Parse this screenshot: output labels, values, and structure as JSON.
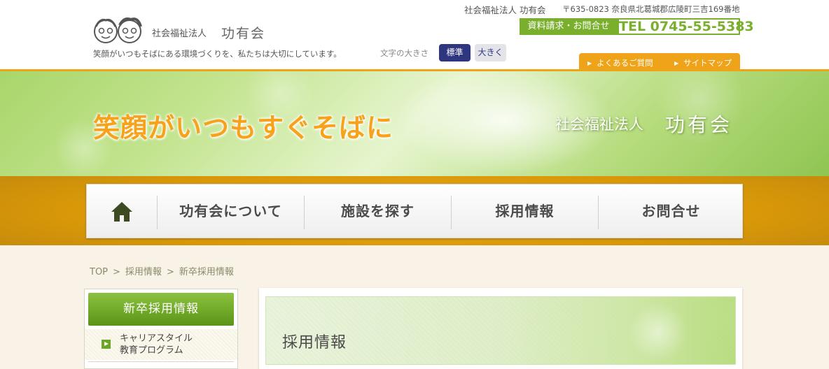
{
  "header": {
    "org_prefix": "社会福祉法人",
    "org_name": "功有会",
    "tagline": "笑顔がいつもそばにある環境づくりを、私たちは大切にしています。",
    "text_size": {
      "label": "文字の大きさ",
      "standard": "標準",
      "large": "大きく"
    },
    "address_org": "社会福祉法人 功有会",
    "address": "〒635-0823 奈良県北葛城郡広陵町三吉169番地",
    "contact_button": "資料請求・お問合せ",
    "tel": "TEL 0745-55-5383",
    "sublinks": [
      "よくあるご質問",
      "サイトマップ"
    ],
    "colors": {
      "accent_orange": "#eea318",
      "accent_green": "#7aaf2d",
      "navy": "#2f3680"
    }
  },
  "banner": {
    "slogan": "笑顔がいつもすぐそばに",
    "org_prefix": "社会福祉法人",
    "org_name": "功有会"
  },
  "nav": {
    "home_icon": "house-icon",
    "items": [
      "功有会について",
      "施設を探す",
      "採用情報",
      "お問合せ"
    ]
  },
  "breadcrumb": [
    "TOP",
    "採用情報",
    "新卒採用情報"
  ],
  "sidebar": {
    "heading": "新卒採用情報",
    "items": [
      {
        "line1": "キャリアスタイル",
        "line2": "教育プログラム"
      }
    ]
  },
  "main": {
    "title": "採用情報"
  }
}
